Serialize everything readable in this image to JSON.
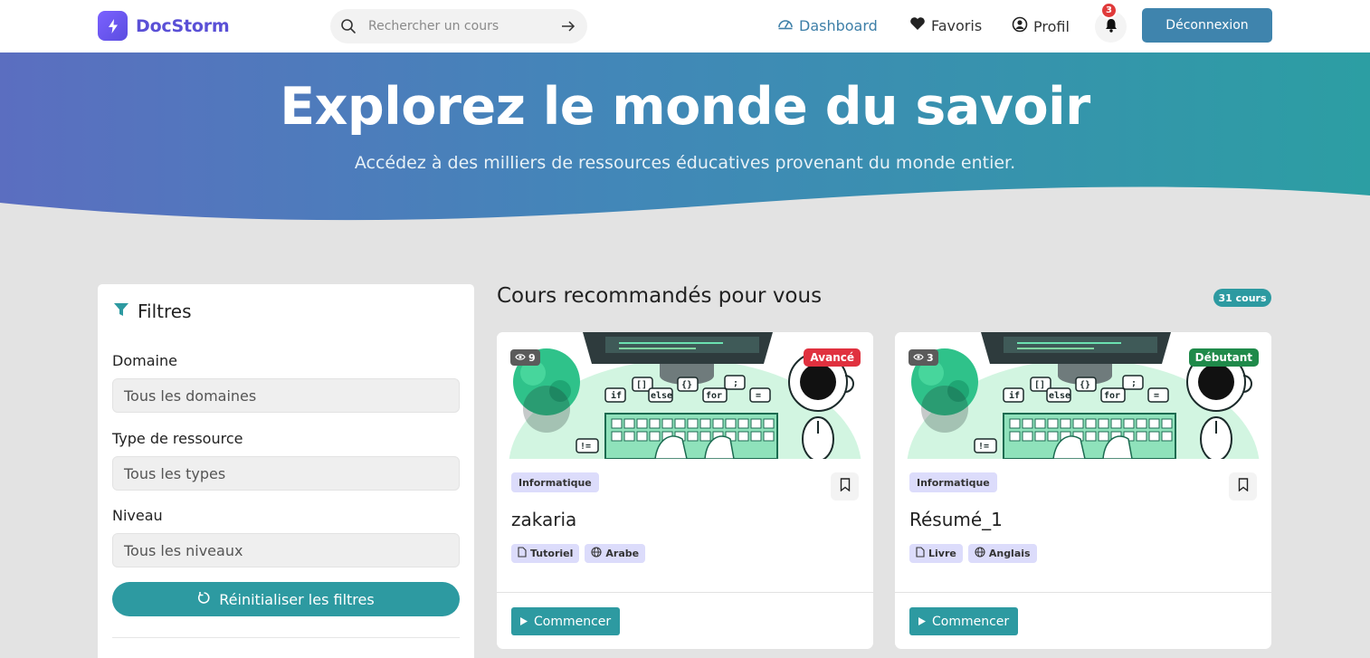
{
  "brand": {
    "name": "DocStorm",
    "accent": "#5a50d6"
  },
  "search": {
    "placeholder": "Rechercher un cours"
  },
  "nav": {
    "dashboard": "Dashboard",
    "favorites": "Favoris",
    "profile": "Profil",
    "notifications_count": "3",
    "logout": "Déconnexion"
  },
  "hero": {
    "title": "Explorez le monde du savoir",
    "subtitle": "Accédez à des milliers de ressources éducatives provenant du monde entier."
  },
  "filters": {
    "title": "Filtres",
    "domain_label": "Domaine",
    "domain_value": "Tous les domaines",
    "type_label": "Type de ressource",
    "type_value": "Tous les types",
    "level_label": "Niveau",
    "level_value": "Tous les niveaux",
    "reset": "Réinitialiser les filtres"
  },
  "courses": {
    "title": "Cours recommandés pour vous",
    "count": "31 cours",
    "items": [
      {
        "views": "9",
        "level": "Avancé",
        "domain": "Informatique",
        "title": "zakaria",
        "type": "Tutoriel",
        "language": "Arabe",
        "cta": "Commencer"
      },
      {
        "views": "3",
        "level": "Débutant",
        "domain": "Informatique",
        "title": "Résumé_1",
        "type": "Livre",
        "language": "Anglais",
        "cta": "Commencer"
      }
    ]
  },
  "colors": {
    "teal": "#2d9aa1",
    "nav_blue": "#3f84ad",
    "danger": "#e0313f",
    "success": "#1f8a4a"
  }
}
